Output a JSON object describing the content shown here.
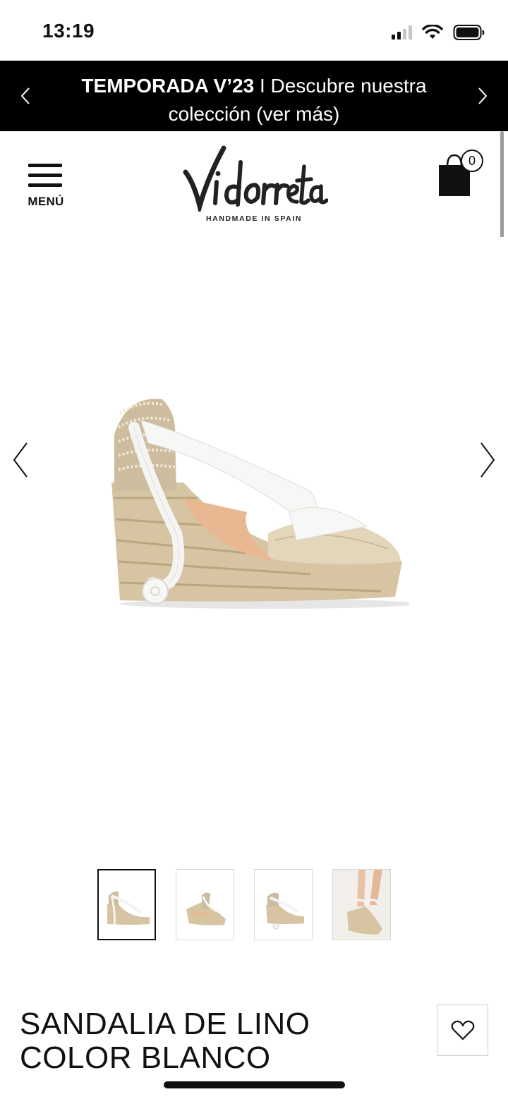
{
  "status_bar": {
    "time": "13:19"
  },
  "promo_banner": {
    "bold_text": "TEMPORADA V’23",
    "separator": "I",
    "text": "Descubre nuestra colección (ver más)"
  },
  "header": {
    "menu_label": "MENÚ",
    "logo_text": "Vidorreta",
    "logo_tagline": "HANDMADE IN SPAIN",
    "cart_count": "0"
  },
  "product": {
    "title": "SANDALIA DE LINO COLOR BLANCO",
    "image_alt": "espadrille-wedge-sandal",
    "thumbnail_count": 4,
    "active_thumbnail": 1
  },
  "colors": {
    "banner_bg": "#000000",
    "jute": "#d8c7a6",
    "ribbon": "#f7f7f5",
    "text": "#111111"
  }
}
